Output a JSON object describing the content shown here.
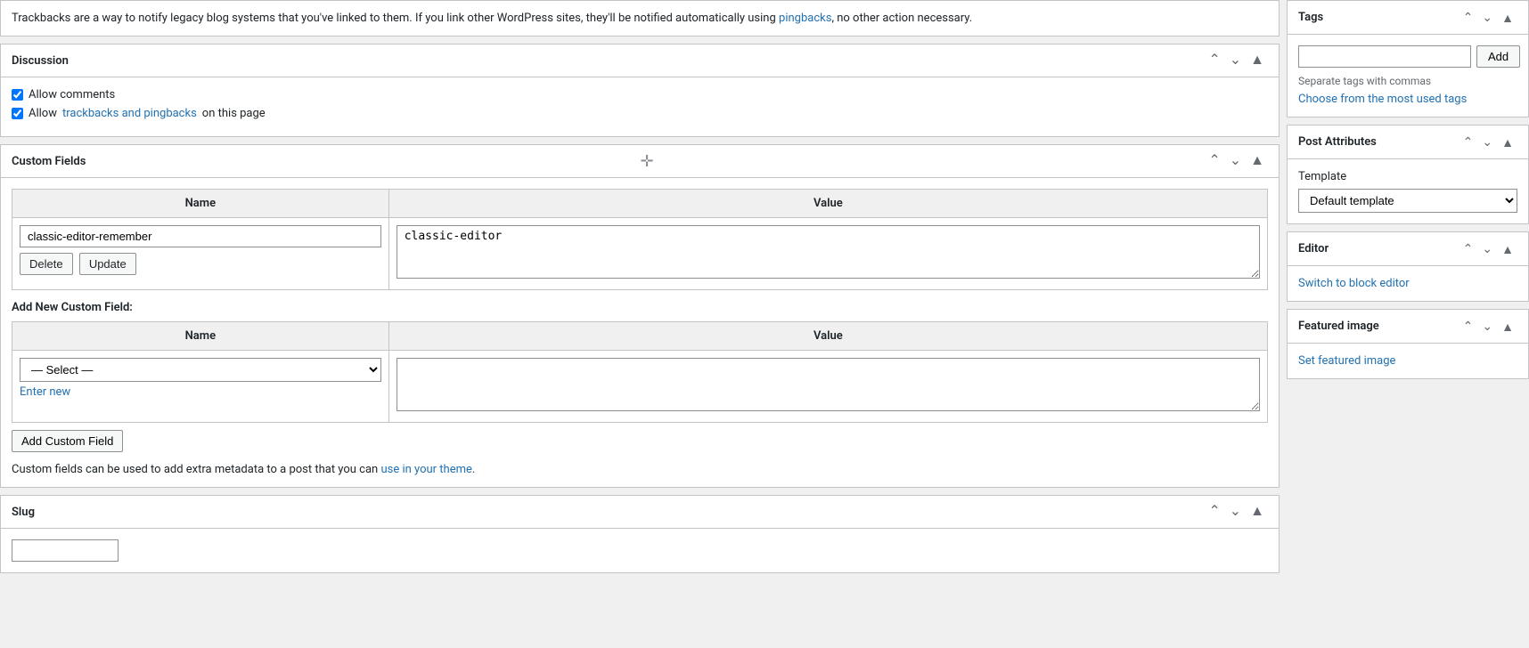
{
  "trackbacks": {
    "text": "Trackbacks are a way to notify legacy blog systems that you've linked to them. If you link other WordPress sites, they'll be notified automatically using ",
    "link_text": "pingbacks",
    "text_end": ", no other action necessary."
  },
  "discussion": {
    "title": "Discussion",
    "allow_comments_label": "Allow comments",
    "allow_trackbacks_prefix": "Allow ",
    "allow_trackbacks_link": "trackbacks and pingbacks",
    "allow_trackbacks_suffix": " on this page"
  },
  "custom_fields": {
    "title": "Custom Fields",
    "name_header": "Name",
    "value_header": "Value",
    "existing_name": "classic-editor-remember",
    "existing_value": "classic-editor",
    "delete_btn": "Delete",
    "update_btn": "Update",
    "add_new_label": "Add New Custom Field:",
    "select_placeholder": "— Select —",
    "enter_new_link": "Enter new",
    "add_button": "Add Custom Field",
    "note_prefix": "Custom fields can be used to add extra metadata to a post that you can ",
    "note_link": "use in your theme",
    "note_suffix": "."
  },
  "slug": {
    "title": "Slug"
  },
  "tags_panel": {
    "title": "Tags",
    "add_btn": "Add",
    "separate_note": "Separate tags with commas",
    "used_tags_link": "Choose from the most used tags",
    "input_placeholder": ""
  },
  "post_attributes": {
    "title": "Post Attributes",
    "template_label": "Template",
    "template_options": [
      "Default template"
    ],
    "selected_template": "Default template"
  },
  "editor_panel": {
    "title": "Editor",
    "switch_link": "Switch to block editor"
  },
  "featured_image_panel": {
    "title": "Featured image",
    "set_link": "Set featured image"
  },
  "icons": {
    "chevron_up": "⌃",
    "chevron_down": "⌄",
    "collapse": "▲",
    "expand": "▼",
    "move": "✛"
  }
}
